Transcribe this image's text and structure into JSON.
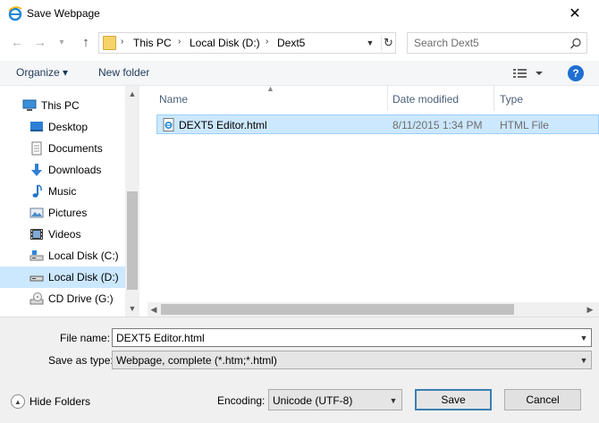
{
  "window": {
    "title": "Save Webpage",
    "close_icon": "close-icon"
  },
  "nav": {
    "back_icon": "arrow-left-icon",
    "forward_icon": "arrow-right-icon",
    "recent_icon": "chevron-down-icon",
    "up_icon": "arrow-up-icon"
  },
  "address": {
    "crumbs": [
      "This PC",
      "Local Disk (D:)",
      "Dext5"
    ]
  },
  "search": {
    "placeholder": "Search Dext5"
  },
  "toolbar": {
    "organize_label": "Organize ▾",
    "new_folder_label": "New folder",
    "help_label": "?"
  },
  "sidebar": {
    "items": [
      {
        "label": "This PC",
        "icon": "computer-icon"
      },
      {
        "label": "Desktop",
        "icon": "desktop-icon"
      },
      {
        "label": "Documents",
        "icon": "documents-icon"
      },
      {
        "label": "Downloads",
        "icon": "downloads-icon"
      },
      {
        "label": "Music",
        "icon": "music-icon"
      },
      {
        "label": "Pictures",
        "icon": "pictures-icon"
      },
      {
        "label": "Videos",
        "icon": "videos-icon"
      },
      {
        "label": "Local Disk (C:)",
        "icon": "drive-icon"
      },
      {
        "label": "Local Disk (D:)",
        "icon": "drive-icon",
        "selected": true
      },
      {
        "label": "CD Drive (G:)",
        "icon": "cd-drive-icon"
      }
    ]
  },
  "filelist": {
    "columns": [
      "Name",
      "Date modified",
      "Type"
    ],
    "rows": [
      {
        "name": "DEXT5 Editor.html",
        "date_modified": "8/11/2015 1:34 PM",
        "type": "HTML File",
        "icon": "html-file-icon"
      }
    ]
  },
  "form": {
    "filename_label": "File name:",
    "filename_value": "DEXT5 Editor.html",
    "savetype_label": "Save as type:",
    "savetype_value": "Webpage, complete (*.htm;*.html)",
    "hide_folders_label": "Hide Folders",
    "encoding_label": "Encoding:",
    "encoding_value": "Unicode (UTF-8)",
    "save_label": "Save",
    "cancel_label": "Cancel"
  },
  "colors": {
    "selection": "#cce8ff",
    "accent": "#1e6fd1",
    "link_text": "#1e395b"
  }
}
